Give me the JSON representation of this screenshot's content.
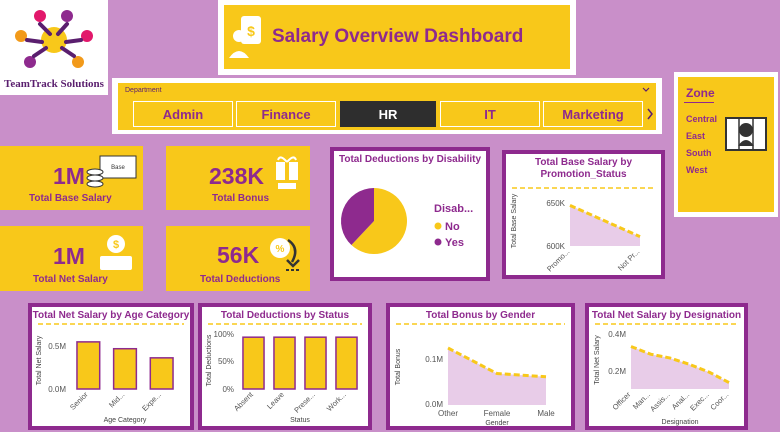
{
  "brand": {
    "name": "TeamTrack Solutions"
  },
  "title": "Salary Overview Dashboard",
  "department": {
    "label": "Department",
    "options": [
      "Admin",
      "Finance",
      "HR",
      "IT",
      "Marketing"
    ],
    "selected": "HR"
  },
  "zone": {
    "title": "Zone",
    "items": [
      "Central",
      "East",
      "South",
      "West"
    ]
  },
  "kpis": {
    "base_salary": {
      "value": "1M",
      "label": "Total Base Salary"
    },
    "bonus": {
      "value": "238K",
      "label": "Total Bonus"
    },
    "net_salary": {
      "value": "1M",
      "label": "Total Net Salary"
    },
    "deductions": {
      "value": "56K",
      "label": "Total Deductions"
    }
  },
  "icons": [
    "logo-icon",
    "salary-icon",
    "cash-stack-icon",
    "gift-icon",
    "payment-icon",
    "deduction-icon",
    "map-icon",
    "chevron-right-icon",
    "chevron-down-icon"
  ],
  "colors": {
    "purple": "#8e2a8e",
    "yellow": "#f8c81a",
    "light_purple": "#e8cce8",
    "background": "#c98fc9"
  },
  "chart_data": [
    {
      "id": "deductions_by_disability",
      "type": "pie",
      "title": "Total Deductions by Disability",
      "legend_title": "Disab...",
      "labels": [
        "No",
        "Yes"
      ],
      "values": [
        62,
        38
      ]
    },
    {
      "id": "base_salary_by_promotion",
      "type": "area",
      "title": "Total Base Salary by Promotion_Status",
      "ylabel": "Total Base Salary",
      "categories": [
        "Promo...",
        "Not Pr..."
      ],
      "values": [
        650000,
        600000
      ],
      "yticks": [
        "650K",
        "600K"
      ],
      "ylim": [
        585000,
        665000
      ]
    },
    {
      "id": "net_salary_by_age",
      "type": "bar",
      "title": "Total Net Salary by Age Category",
      "xlabel": "Age Category",
      "ylabel": "Total Net Salary",
      "categories": [
        "Senior",
        "Mid...",
        "Expe..."
      ],
      "values": [
        0.62,
        0.53,
        0.41
      ],
      "yticks": [
        "0.5M",
        "0.0M"
      ],
      "ylim": [
        0,
        0.75
      ]
    },
    {
      "id": "deductions_by_status",
      "type": "bar",
      "title": "Total Deductions by Status",
      "xlabel": "Status",
      "ylabel": "Total Deductions",
      "categories": [
        "Absent",
        "Leave",
        "Prese...",
        "Work..."
      ],
      "values": [
        100,
        100,
        100,
        100
      ],
      "yticks": [
        "100%",
        "50%",
        "0%"
      ],
      "ylim": [
        0,
        110
      ]
    },
    {
      "id": "bonus_by_gender",
      "type": "area",
      "title": "Total Bonus by Gender",
      "xlabel": "Gender",
      "ylabel": "Total Bonus",
      "categories": [
        "Other",
        "Female",
        "Male"
      ],
      "values": [
        1.05,
        0.58,
        0.52
      ],
      "yticks": [
        "0.1M",
        "0.0M"
      ],
      "ylim": [
        0,
        1.4
      ]
    },
    {
      "id": "net_salary_by_designation",
      "type": "area",
      "title": "Total Net Salary by Designation",
      "xlabel": "Designation",
      "ylabel": "Total Net Salary",
      "categories": [
        "Officer",
        "Man...",
        "Assis...",
        "Anal...",
        "Exec...",
        "Coor..."
      ],
      "values": [
        0.33,
        0.27,
        0.24,
        0.19,
        0.13,
        0.05
      ],
      "yticks": [
        "0.4M",
        "0.2M"
      ],
      "ylim": [
        0,
        0.45
      ]
    }
  ]
}
